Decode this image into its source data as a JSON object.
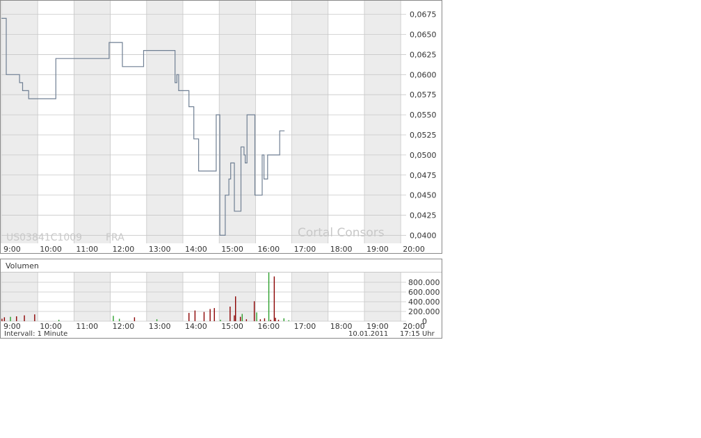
{
  "colors": {
    "band": "#ececec",
    "grid": "#c8c8c8",
    "frame": "#888888",
    "price_line": "#6f7f93",
    "vol_up": "#2ca02c",
    "vol_down": "#8b0000",
    "watermark": "#c8c8c8",
    "text": "#333333"
  },
  "chart_data": [
    {
      "type": "line",
      "title": "",
      "xlabel": "",
      "ylabel": "",
      "x_ticks": [
        "9:00",
        "10:00",
        "11:00",
        "12:00",
        "13:00",
        "14:00",
        "15:00",
        "16:00",
        "17:00",
        "18:00",
        "19:00",
        "20:00"
      ],
      "y_ticks": [
        "0,0400",
        "0,0425",
        "0,0450",
        "0,0475",
        "0,0500",
        "0,0525",
        "0,0550",
        "0,0575",
        "0,0600",
        "0,0625",
        "0,0650",
        "0,0675"
      ],
      "xlim": [
        "9:00",
        "20:00"
      ],
      "ylim": [
        0.039,
        0.0692
      ],
      "grid": true,
      "step": true,
      "annotations": {
        "isin": "US03841C1009",
        "exchange": "FRA",
        "brand": "Cortal Consors"
      },
      "series": [
        {
          "x": [
            "9:00",
            "9:08",
            "9:08",
            "9:30",
            "9:30",
            "9:35",
            "9:35",
            "9:45",
            "9:45",
            "9:58",
            "9:58",
            "10:30",
            "10:30",
            "11:36",
            "11:36",
            "11:58",
            "11:58",
            "12:20",
            "12:20",
            "12:55",
            "12:55",
            "13:47",
            "13:47",
            "13:50",
            "13:50",
            "13:53",
            "13:53",
            "14:10",
            "14:10",
            "14:18",
            "14:18",
            "14:26",
            "14:26",
            "14:55",
            "14:55",
            "15:01",
            "15:01",
            "15:10",
            "15:10",
            "15:16",
            "15:16",
            "15:19",
            "15:19",
            "15:25",
            "15:25",
            "15:36",
            "15:36",
            "15:41",
            "15:41",
            "15:43",
            "15:43",
            "15:46",
            "15:46",
            "15:59",
            "15:59",
            "16:11",
            "16:11",
            "16:14",
            "16:14",
            "16:20",
            "16:20",
            "16:40",
            "16:40",
            "16:45",
            "16:45",
            "16:48"
          ],
          "y": [
            0.067,
            0.067,
            0.06,
            0.06,
            0.059,
            0.059,
            0.058,
            0.058,
            0.057,
            0.057,
            0.057,
            0.057,
            0.062,
            0.062,
            0.062,
            0.062,
            0.064,
            0.064,
            0.061,
            0.061,
            0.063,
            0.063,
            0.059,
            0.059,
            0.06,
            0.06,
            0.058,
            0.058,
            0.056,
            0.056,
            0.052,
            0.052,
            0.048,
            0.048,
            0.055,
            0.055,
            0.04,
            0.04,
            0.045,
            0.045,
            0.047,
            0.047,
            0.049,
            0.049,
            0.043,
            0.043,
            0.051,
            0.051,
            0.05,
            0.05,
            0.049,
            0.049,
            0.055,
            0.055,
            0.045,
            0.045,
            0.05,
            0.05,
            0.047,
            0.047,
            0.05,
            0.05,
            0.053,
            0.053,
            0.053,
            0.053
          ]
        }
      ]
    },
    {
      "type": "bar",
      "title": "Volumen",
      "xlabel": "",
      "ylabel": "",
      "x_ticks": [
        "9:00",
        "10:00",
        "11:00",
        "12:00",
        "13:00",
        "14:00",
        "15:00",
        "16:00",
        "17:00",
        "18:00",
        "19:00",
        "20:00"
      ],
      "y_ticks": [
        "0",
        "200.000",
        "400.000",
        "600.000",
        "800.000"
      ],
      "xlim": [
        "9:00",
        "20:00"
      ],
      "ylim": [
        0,
        1000000
      ],
      "grid": true,
      "footer": {
        "interval": "Intervall: 1 Minute",
        "date": "10.01.2011",
        "time": "17:15 Uhr"
      },
      "bars": [
        {
          "t": "9:01",
          "v": 50000,
          "dir": "down"
        },
        {
          "t": "9:05",
          "v": 80000,
          "dir": "down"
        },
        {
          "t": "9:15",
          "v": 90000,
          "dir": "up"
        },
        {
          "t": "9:25",
          "v": 100000,
          "dir": "down"
        },
        {
          "t": "9:38",
          "v": 120000,
          "dir": "down"
        },
        {
          "t": "9:55",
          "v": 140000,
          "dir": "down"
        },
        {
          "t": "10:35",
          "v": 30000,
          "dir": "up"
        },
        {
          "t": "12:05",
          "v": 110000,
          "dir": "up"
        },
        {
          "t": "12:15",
          "v": 50000,
          "dir": "up"
        },
        {
          "t": "12:40",
          "v": 80000,
          "dir": "down"
        },
        {
          "t": "13:17",
          "v": 40000,
          "dir": "up"
        },
        {
          "t": "14:10",
          "v": 170000,
          "dir": "down"
        },
        {
          "t": "14:20",
          "v": 220000,
          "dir": "down"
        },
        {
          "t": "14:35",
          "v": 190000,
          "dir": "down"
        },
        {
          "t": "14:45",
          "v": 250000,
          "dir": "down"
        },
        {
          "t": "14:52",
          "v": 270000,
          "dir": "down"
        },
        {
          "t": "15:02",
          "v": 30000,
          "dir": "up"
        },
        {
          "t": "15:18",
          "v": 300000,
          "dir": "down"
        },
        {
          "t": "15:25",
          "v": 120000,
          "dir": "down"
        },
        {
          "t": "15:27",
          "v": 510000,
          "dir": "down"
        },
        {
          "t": "15:35",
          "v": 90000,
          "dir": "down"
        },
        {
          "t": "15:38",
          "v": 150000,
          "dir": "up"
        },
        {
          "t": "15:45",
          "v": 40000,
          "dir": "down"
        },
        {
          "t": "15:58",
          "v": 410000,
          "dir": "down"
        },
        {
          "t": "16:02",
          "v": 180000,
          "dir": "up"
        },
        {
          "t": "16:08",
          "v": 40000,
          "dir": "down"
        },
        {
          "t": "16:15",
          "v": 60000,
          "dir": "down"
        },
        {
          "t": "16:22",
          "v": 1000000,
          "dir": "up"
        },
        {
          "t": "16:25",
          "v": 30000,
          "dir": "down"
        },
        {
          "t": "16:31",
          "v": 920000,
          "dir": "down"
        },
        {
          "t": "16:33",
          "v": 70000,
          "dir": "down"
        },
        {
          "t": "16:38",
          "v": 30000,
          "dir": "down"
        },
        {
          "t": "16:47",
          "v": 60000,
          "dir": "up"
        },
        {
          "t": "16:55",
          "v": 20000,
          "dir": "up"
        }
      ]
    }
  ]
}
